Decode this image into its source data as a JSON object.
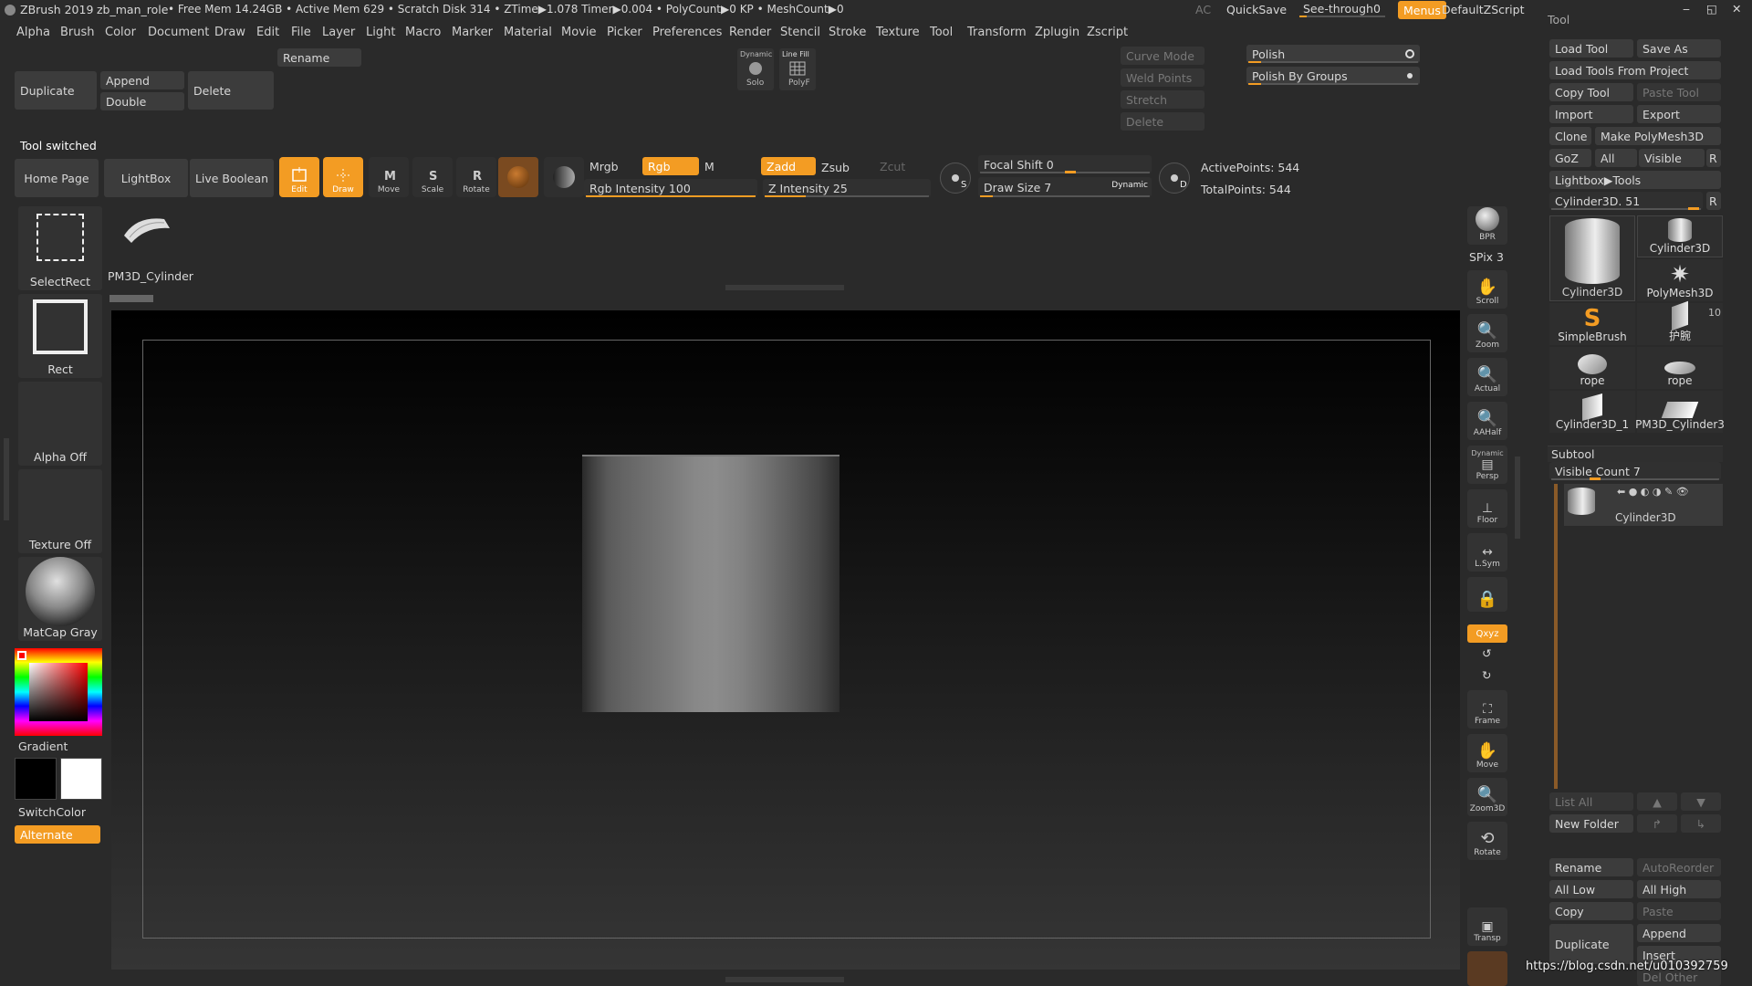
{
  "title_bar": {
    "app": "ZBrush 2019",
    "project": "zb_man_role",
    "status": "• Free Mem 14.24GB • Active Mem 629 • Scratch Disk 314 • ZTime▶1.078 Timer▶0.004 • PolyCount▶0 KP • MeshCount▶0",
    "ac": "AC",
    "quicksave": "QuickSave",
    "see_through": "See-through",
    "see_through_value": "0",
    "menus": "Menus",
    "script": "DefaultZScript"
  },
  "menubar": [
    "Alpha",
    "Brush",
    "Color",
    "Document",
    "Draw",
    "Edit",
    "File",
    "Layer",
    "Light",
    "Macro",
    "Marker",
    "Material",
    "Movie",
    "Picker",
    "Preferences",
    "Render",
    "Stencil",
    "Stroke",
    "Texture",
    "Tool",
    "Transform",
    "Zplugin",
    "Zscript"
  ],
  "top_palette": {
    "rename": "Rename",
    "duplicate": "Duplicate",
    "append": "Append",
    "double": "Double",
    "delete": "Delete",
    "dynamic": "Dynamic",
    "solo": "Solo",
    "line_fill": "Line Fill",
    "polyf": "PolyF",
    "curve_mode": "Curve Mode",
    "weld_points": "Weld Points",
    "stretch": "Stretch",
    "delete2": "Delete",
    "polish": "Polish",
    "polish_by_groups": "Polish By Groups"
  },
  "notice": "Tool switched",
  "shelf": {
    "home": "Home Page",
    "lightbox": "LightBox",
    "live_boolean": "Live Boolean",
    "edit": "Edit",
    "draw": "Draw",
    "move": "Move",
    "scale": "Scale",
    "rotate": "Rotate",
    "mrgb": "Mrgb",
    "rgb": "Rgb",
    "m": "M",
    "rgb_intensity": "Rgb Intensity 100",
    "rgb_intensity_value": 1.0,
    "zadd": "Zadd",
    "zsub": "Zsub",
    "zcut": "Zcut",
    "z_intensity": "Z Intensity 25",
    "z_intensity_value": 0.25,
    "focal_shift": "Focal Shift 0",
    "draw_size": "Draw Size 7",
    "dynamic": "Dynamic",
    "active_points": "ActivePoints: 544",
    "total_points": "TotalPoints: 544"
  },
  "left_panel": {
    "select_rect": "SelectRect",
    "rect": "Rect",
    "alpha_off": "Alpha Off",
    "texture_off": "Texture Off",
    "matcap": "MatCap Gray",
    "gradient": "Gradient",
    "switch_color": "SwitchColor",
    "alternate": "Alternate"
  },
  "current_tool": {
    "name": "PM3D_Cylinder"
  },
  "right_tray": {
    "bpr": "BPR",
    "spix": "SPix 3",
    "scroll": "Scroll",
    "zoom": "Zoom",
    "actual": "Actual",
    "aahalf": "AAHalf",
    "dynamic": "Dynamic",
    "persp": "Persp",
    "floor": "Floor",
    "lsym": "L.Sym",
    "xyz": "Qxyz",
    "frame": "Frame",
    "move": "Move",
    "zoom3d": "Zoom3D",
    "rotate": "Rotate",
    "transp": "Transp"
  },
  "tool_panel": {
    "title": "Tool",
    "load_tool": "Load Tool",
    "save_as": "Save As",
    "load_from_project": "Load Tools From Project",
    "copy_tool": "Copy Tool",
    "paste_tool": "Paste Tool",
    "import": "Import",
    "export": "Export",
    "clone": "Clone",
    "make_polymesh": "Make PolyMesh3D",
    "goz": "GoZ",
    "all": "All",
    "visible": "Visible",
    "r": "R",
    "lightbox_tools": "Lightbox▶Tools",
    "current": "Cylinder3D. 51",
    "tools": [
      "Cylinder3D",
      "Cylinder3D",
      "PolyMesh3D",
      "SimpleBrush",
      "护腕",
      "rope",
      "rope",
      "Cylinder3D_1",
      "PM3D_Cylinder3"
    ],
    "badge": "10"
  },
  "subtool": {
    "title": "Subtool",
    "visible_count": "Visible Count 7",
    "item": "Cylinder3D",
    "list_all": "List All",
    "new_folder": "New Folder",
    "rename": "Rename",
    "auto_reorder": "AutoReorder",
    "all_low": "All Low",
    "all_high": "All High",
    "copy": "Copy",
    "paste": "Paste",
    "duplicate": "Duplicate",
    "append": "Append",
    "insert": "Insert",
    "del_other": "Del Other"
  },
  "watermark": "https://blog.csdn.net/u010392759"
}
